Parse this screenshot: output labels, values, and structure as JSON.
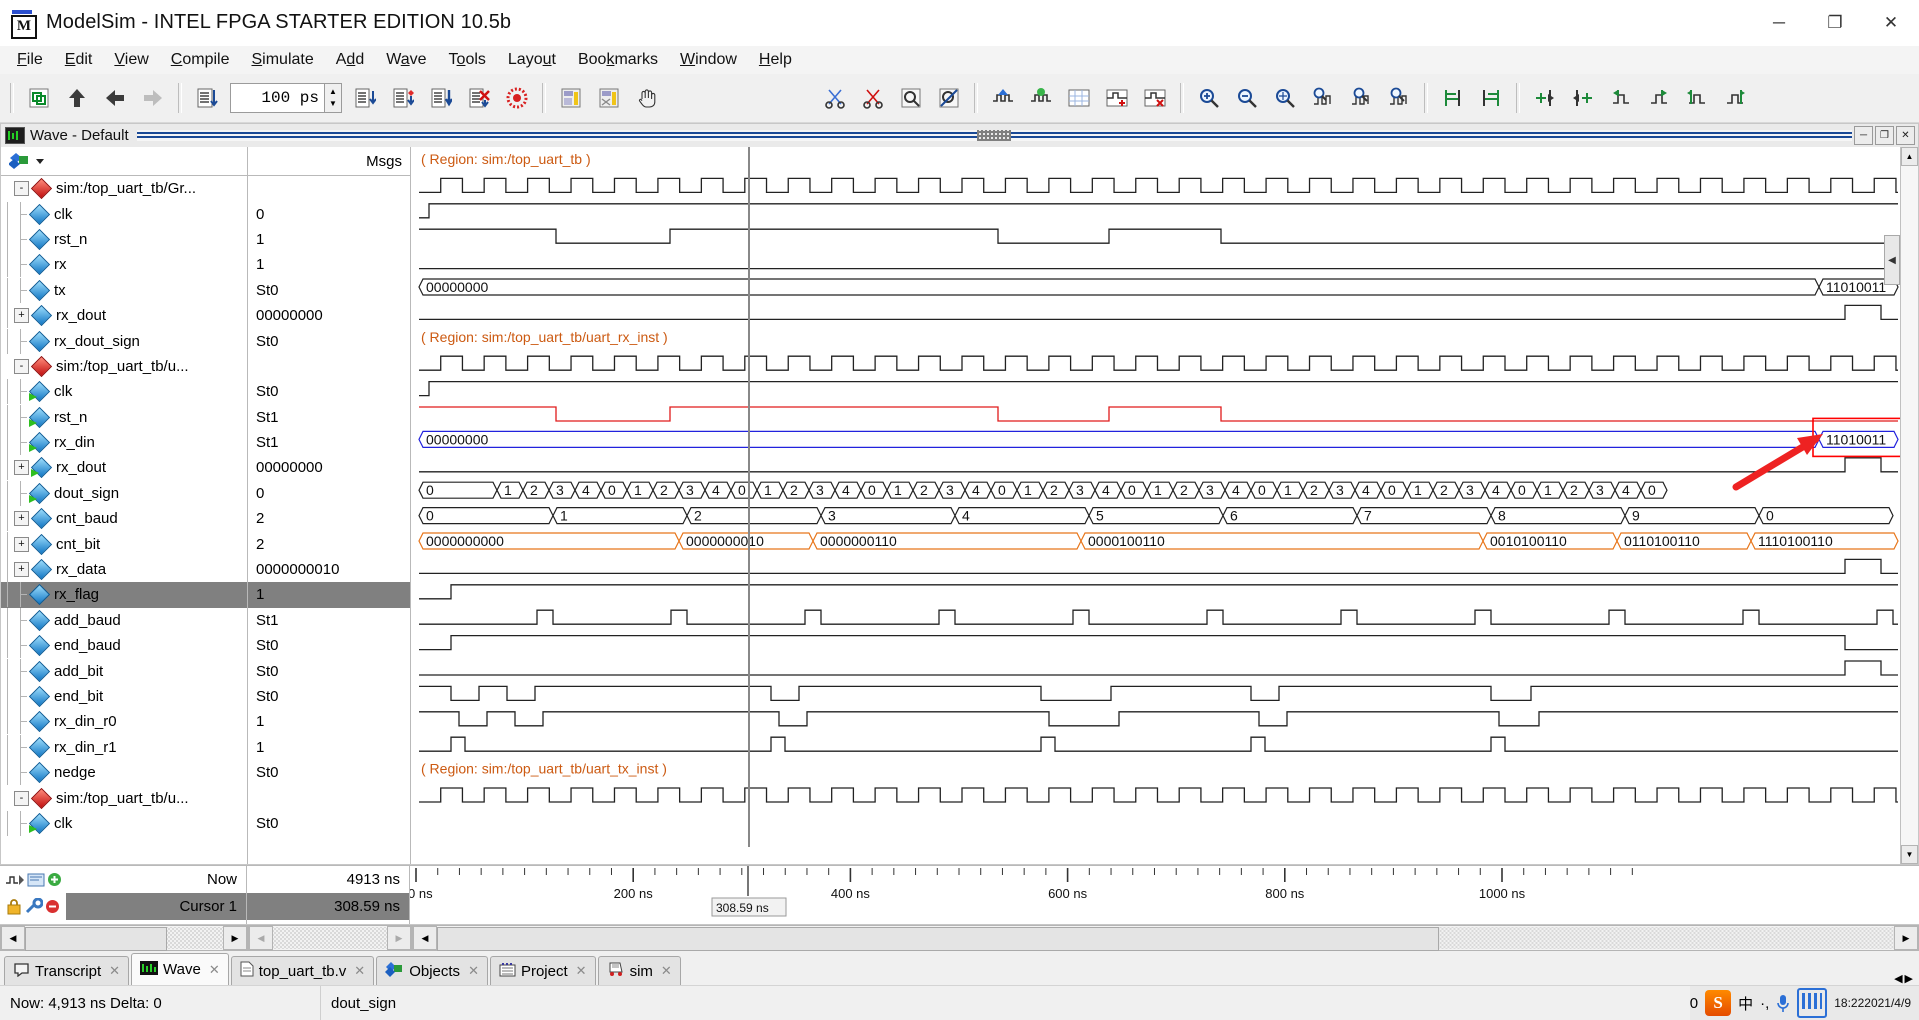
{
  "window": {
    "title": "ModelSim - INTEL FPGA STARTER EDITION 10.5b",
    "minimize": "─",
    "maximize": "❐",
    "close": "✕"
  },
  "menu": [
    {
      "label": "File",
      "accel": "F"
    },
    {
      "label": "Edit",
      "accel": "E"
    },
    {
      "label": "View",
      "accel": "V"
    },
    {
      "label": "Compile",
      "accel": "C"
    },
    {
      "label": "Simulate",
      "accel": "S"
    },
    {
      "label": "Add",
      "accel": "d"
    },
    {
      "label": "Wave",
      "accel": "a"
    },
    {
      "label": "Tools",
      "accel": "o"
    },
    {
      "label": "Layout",
      "accel": "u"
    },
    {
      "label": "Bookmarks",
      "accel": "k"
    },
    {
      "label": "Window",
      "accel": "W"
    },
    {
      "label": "Help",
      "accel": "H"
    }
  ],
  "toolbar": {
    "run_length_value": "100 ps",
    "spin_up": "▲",
    "spin_down": "▼",
    "icons": [
      "new-window-icon",
      "up-arrow-icon",
      "back-arrow-icon",
      "forward-arrow-icon",
      "restart-icon",
      "run-icon",
      "continue-run-icon",
      "run-all-icon",
      "break-icon",
      "stop-icon",
      "coverage-icon",
      "coverage-exclude-icon",
      "hand-pan-icon",
      "cut-icon",
      "delete-icon",
      "find-icon",
      "no-find-icon",
      "wave-insert-icon",
      "wave-compare-icon",
      "wave-grid-icon",
      "wave-add-icon",
      "wave-del-icon",
      "zoom-in-icon",
      "zoom-out-icon",
      "zoom-full-icon",
      "zoom-cursor-icon",
      "zoom-range-icon",
      "zoom-last-icon",
      "align-left-icon",
      "align-right-icon",
      "insert-cursor-left-icon",
      "insert-cursor-right-icon",
      "prev-transition-icon",
      "next-transition-icon",
      "prev-edge-icon",
      "next-edge-icon"
    ]
  },
  "wave_window": {
    "title": "Wave - Default",
    "minimize": "─",
    "restore": "❐",
    "close": "✕",
    "value_header": "Msgs",
    "flyout_label": "◀"
  },
  "signals": [
    {
      "name": "sim:/top_uart_tb/Gr...",
      "value": "",
      "type": "region",
      "expand": "-",
      "indent": 0,
      "selected": false
    },
    {
      "name": "clk",
      "value": "0",
      "type": "sig",
      "expand": "",
      "indent": 1,
      "selected": false
    },
    {
      "name": "rst_n",
      "value": "1",
      "type": "sig",
      "expand": "",
      "indent": 1,
      "selected": false
    },
    {
      "name": "rx",
      "value": "1",
      "type": "sig",
      "expand": "",
      "indent": 1,
      "selected": false
    },
    {
      "name": "tx",
      "value": "St0",
      "type": "sig",
      "expand": "",
      "indent": 1,
      "selected": false
    },
    {
      "name": "rx_dout",
      "value": "00000000",
      "type": "sig",
      "expand": "+",
      "indent": 1,
      "selected": false
    },
    {
      "name": "rx_dout_sign",
      "value": "St0",
      "type": "sig",
      "expand": "",
      "indent": 1,
      "selected": false
    },
    {
      "name": "sim:/top_uart_tb/u...",
      "value": "",
      "type": "region",
      "expand": "-",
      "indent": 0,
      "selected": false
    },
    {
      "name": "clk",
      "value": "St0",
      "type": "port",
      "expand": "",
      "indent": 1,
      "selected": false
    },
    {
      "name": "rst_n",
      "value": "St1",
      "type": "port",
      "expand": "",
      "indent": 1,
      "selected": false
    },
    {
      "name": "rx_din",
      "value": "St1",
      "type": "port",
      "expand": "",
      "indent": 1,
      "selected": false
    },
    {
      "name": "rx_dout",
      "value": "00000000",
      "type": "port",
      "expand": "+",
      "indent": 1,
      "selected": false
    },
    {
      "name": "dout_sign",
      "value": "0",
      "type": "port",
      "expand": "",
      "indent": 1,
      "selected": false
    },
    {
      "name": "cnt_baud",
      "value": "2",
      "type": "sig",
      "expand": "+",
      "indent": 1,
      "selected": false
    },
    {
      "name": "cnt_bit",
      "value": "2",
      "type": "sig",
      "expand": "+",
      "indent": 1,
      "selected": false
    },
    {
      "name": "rx_data",
      "value": "0000000010",
      "type": "sig",
      "expand": "+",
      "indent": 1,
      "selected": false
    },
    {
      "name": "rx_flag",
      "value": "1",
      "type": "sig",
      "expand": "",
      "indent": 1,
      "selected": true
    },
    {
      "name": "add_baud",
      "value": "St1",
      "type": "sig",
      "expand": "",
      "indent": 1,
      "selected": false
    },
    {
      "name": "end_baud",
      "value": "St0",
      "type": "sig",
      "expand": "",
      "indent": 1,
      "selected": false
    },
    {
      "name": "add_bit",
      "value": "St0",
      "type": "sig",
      "expand": "",
      "indent": 1,
      "selected": false
    },
    {
      "name": "end_bit",
      "value": "St0",
      "type": "sig",
      "expand": "",
      "indent": 1,
      "selected": false
    },
    {
      "name": "rx_din_r0",
      "value": "1",
      "type": "sig",
      "expand": "",
      "indent": 1,
      "selected": false
    },
    {
      "name": "rx_din_r1",
      "value": "1",
      "type": "sig",
      "expand": "",
      "indent": 1,
      "selected": false
    },
    {
      "name": "nedge",
      "value": "St0",
      "type": "sig",
      "expand": "",
      "indent": 1,
      "selected": false
    },
    {
      "name": "sim:/top_uart_tb/u...",
      "value": "",
      "type": "region",
      "expand": "-",
      "indent": 0,
      "selected": false
    },
    {
      "name": "clk",
      "value": "St0",
      "type": "port",
      "expand": "",
      "indent": 1,
      "selected": false
    }
  ],
  "wave": {
    "region_labels": [
      "( Region: sim:/top_uart_tb )",
      "( Region: sim:/top_uart_tb/uart_rx_inst )",
      "( Region: sim:/top_uart_tb/uart_tx_inst )"
    ],
    "bus_labels": {
      "rx_dout_tb_initial": "00000000",
      "rx_dout_tb_final": "11010011",
      "rx_dout_rx_initial": "00000000",
      "rx_dout_rx_final": "11010011"
    },
    "cnt_baud_values": [
      "0",
      "1",
      "2",
      "3",
      "4",
      "0",
      "1",
      "2",
      "3",
      "4",
      "0",
      "1",
      "2",
      "3",
      "4",
      "0",
      "1",
      "2",
      "3",
      "4",
      "0",
      "1",
      "2",
      "3",
      "4",
      "0",
      "1",
      "2",
      "3",
      "4",
      "0",
      "1",
      "2",
      "3",
      "4",
      "0",
      "1",
      "2",
      "3",
      "4",
      "0",
      "1",
      "2",
      "3",
      "4",
      "0"
    ],
    "cnt_bit_values": [
      "0",
      "1",
      "2",
      "3",
      "4",
      "5",
      "6",
      "7",
      "8",
      "9",
      "0"
    ],
    "rx_data_values": [
      "0000000000",
      "0000000010",
      "0000000110",
      "0000100110",
      "0010100110",
      "0110100110",
      "1110100110"
    ],
    "annotation": {
      "highlight_box_color": "#ff0000",
      "arrow_color": "#ee2222"
    }
  },
  "timeline": {
    "ticks": [
      "0 ns",
      "200 ns",
      "400 ns",
      "600 ns",
      "800 ns",
      "1000 ns"
    ],
    "cursor_flag": "308.59 ns"
  },
  "cursor_panel": {
    "now_label": "Now",
    "now_value": "4913 ns",
    "cursor_label": "Cursor 1",
    "cursor_value": "308.59 ns"
  },
  "tabs": [
    {
      "label": "Transcript",
      "icon": "transcript-icon",
      "active": false,
      "closable": true
    },
    {
      "label": "Wave",
      "icon": "wave-icon",
      "active": true,
      "closable": true
    },
    {
      "label": "top_uart_tb.v",
      "icon": "file-icon",
      "active": false,
      "closable": true
    },
    {
      "label": "Objects",
      "icon": "objects-icon",
      "active": false,
      "closable": true
    },
    {
      "label": "Project",
      "icon": "project-icon",
      "active": false,
      "closable": true
    },
    {
      "label": "sim",
      "icon": "sim-icon",
      "active": false,
      "closable": true
    }
  ],
  "statusbar": {
    "now_delta": "Now: 4,913 ns  Delta: 0",
    "selected_signal": "dout_sign"
  },
  "tray": {
    "left_value": "0",
    "logo": "S",
    "ime_mode": "中",
    "punct": "·,",
    "mic": "🎤",
    "clock_line1": "18:22",
    "clock_line2": "2021/4/9"
  },
  "colors": {
    "accent_blue": "#1b4a96",
    "selection_gray": "#808080",
    "bus_orange": "#e8761b",
    "signal_red": "#e01b1b",
    "signal_blue": "#2222dd",
    "waveform_black": "#222222"
  }
}
